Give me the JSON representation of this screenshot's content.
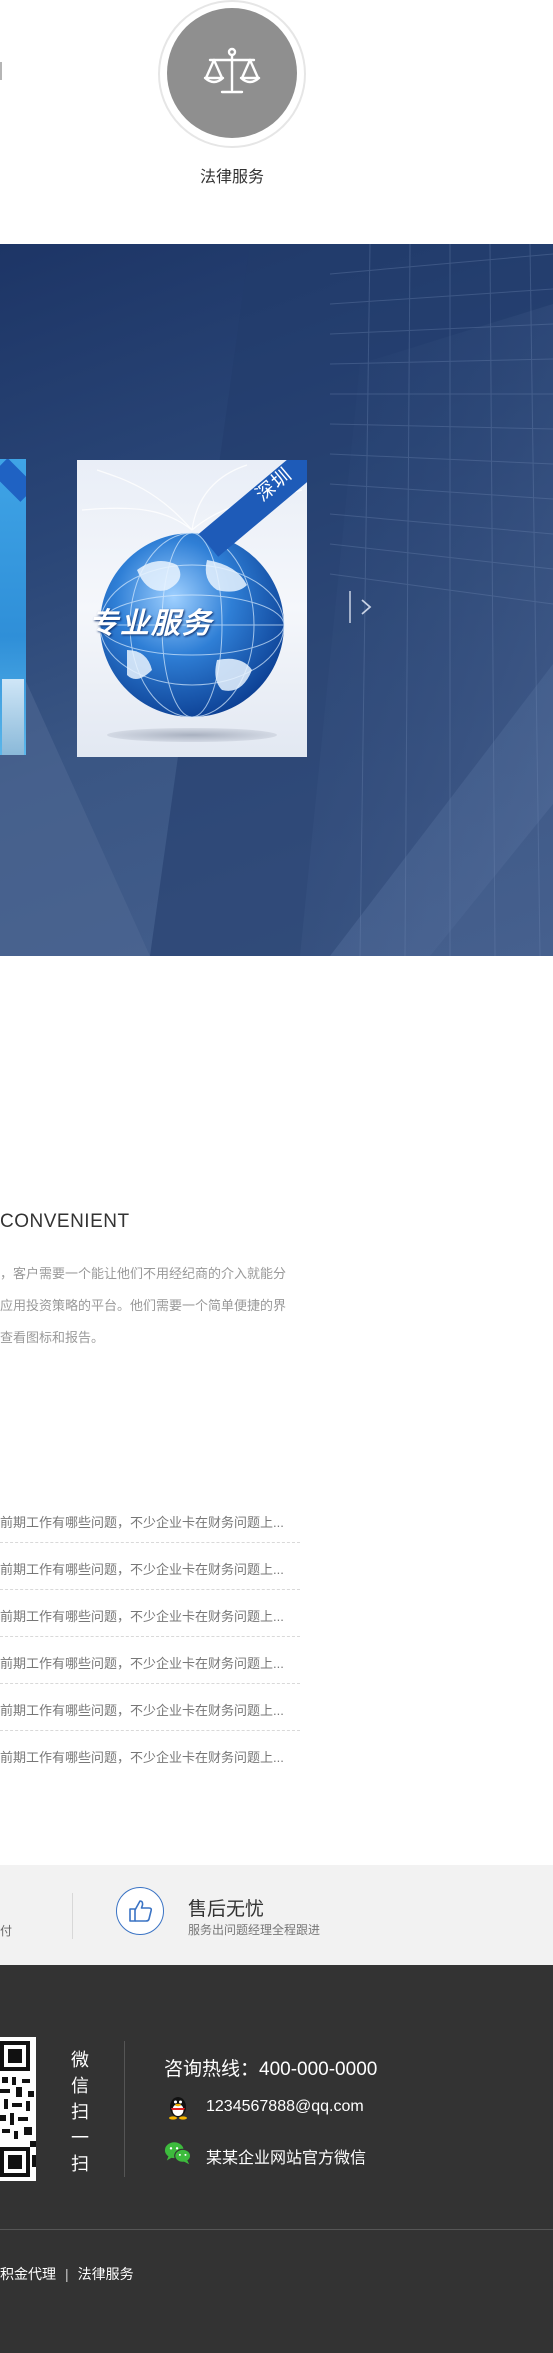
{
  "service_top": {
    "law_label": "法律服务"
  },
  "banner": {
    "card_main_tag": "深圳",
    "card_main_text": "专业服务"
  },
  "convenient": {
    "title": "CONVENIENT",
    "lines": [
      "，客户需要一个能让他们不用经纪商的介入就能分",
      "应用投资策略的平台。他们需要一个简单便捷的界",
      "查看图标和报告。"
    ]
  },
  "news": {
    "items": [
      "前期工作有哪些问题，不少企业卡在财务问题上...",
      "前期工作有哪些问题，不少企业卡在财务问题上...",
      "前期工作有哪些问题，不少企业卡在财务问题上...",
      "前期工作有哪些问题，不少企业卡在财务问题上...",
      "前期工作有哪些问题，不少企业卡在财务问题上...",
      "前期工作有哪些问题，不少企业卡在财务问题上..."
    ]
  },
  "features": {
    "left_fragment": "付",
    "aftersale_title": "售后无忧",
    "aftersale_sub": "服务出问题经理全程跟进"
  },
  "footer": {
    "scan_chars": [
      "微",
      "信",
      "扫",
      "一",
      "扫"
    ],
    "hotline": "咨询热线：400-000-0000",
    "qq": "1234567888@qq.com",
    "wechat": "某某企业网站官方微信",
    "bottom_links": [
      "积金代理",
      "法律服务"
    ],
    "bottom_sep": "|"
  },
  "colors": {
    "banner_dark": "#1d3566",
    "footer_bg": "#333333",
    "strip_bg": "#f2f2f2",
    "accent_blue": "#3a73c4",
    "icon_grey": "#8f8f8f"
  },
  "icons": {
    "law": "scales-icon",
    "aftersale": "thumbs-up-icon",
    "qq": "qq-penguin-icon",
    "wechat": "wechat-icon",
    "next": "chevron-right-icon"
  }
}
